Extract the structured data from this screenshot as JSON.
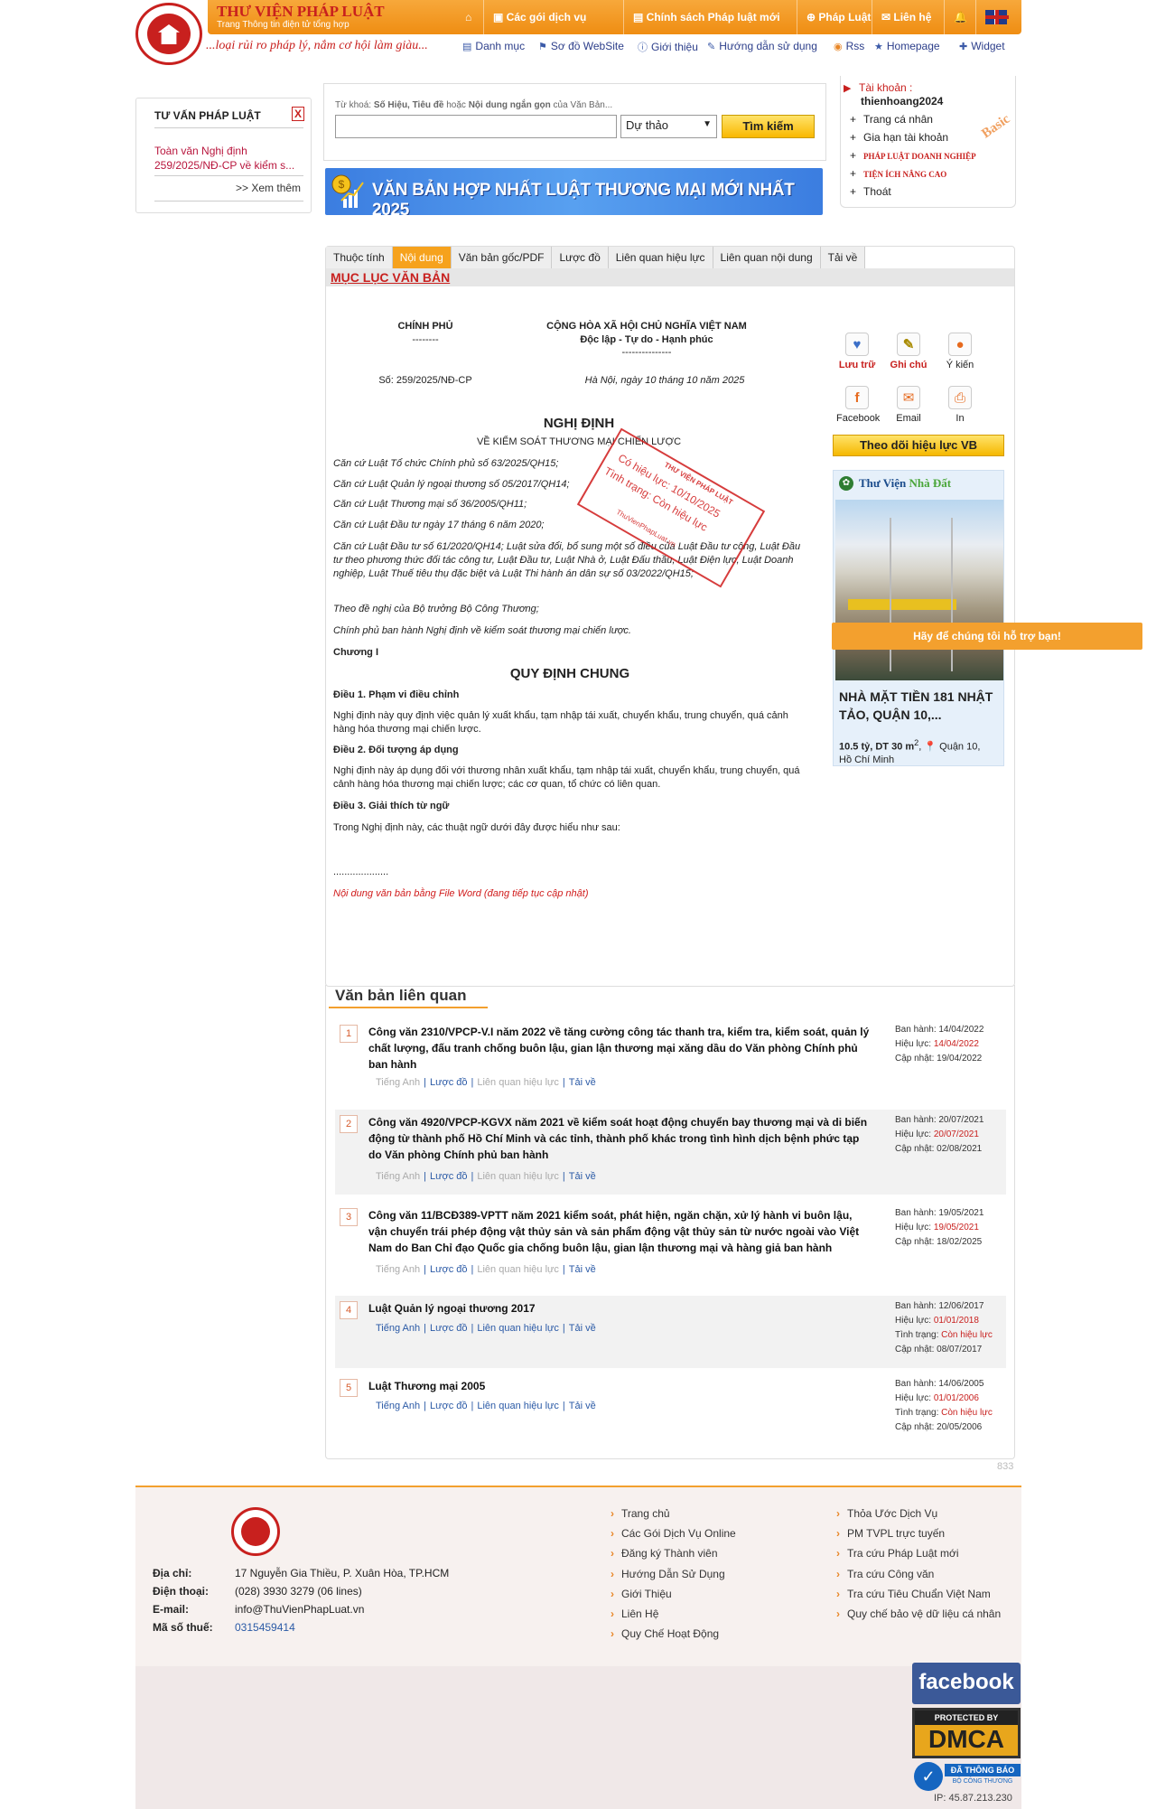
{
  "header": {
    "site_title": "THƯ VIỆN PHÁP LUẬT",
    "site_subtitle": "Trang Thông tin điện tử tổng hợp",
    "slogan": "...loại rủi ro pháp lý, nắm cơ hội làm giàu...",
    "topnav": [
      "Các gói dịch vụ",
      "Chính sách Pháp luật mới",
      "Pháp Luật",
      "Liên hệ"
    ],
    "subnav": [
      "Danh mục",
      "Sơ đồ WebSite",
      "Giới thiệu",
      "Hướng dẫn sử dụng",
      "Rss",
      "Homepage",
      "Widget"
    ]
  },
  "left_box": {
    "title": "TƯ VẤN PHÁP LUẬT",
    "close": "X",
    "link": "Toàn văn Nghị định 259/2025/NĐ-CP về kiểm s...",
    "more": ">> Xem thêm"
  },
  "search": {
    "hint_prefix": "Từ khoá: ",
    "hint_b1": "Số Hiệu, Tiêu đề",
    "hint_mid1": " hoặc ",
    "hint_b2": "Nội dung ngắn gọn",
    "hint_suffix": " của Văn Bản...",
    "value": "",
    "select": "Dự thảo",
    "button": "Tìm kiếm"
  },
  "banner": {
    "text": "VĂN BẢN HỢP NHẤT LUẬT THƯƠNG MẠI MỚI NHẤT 2025"
  },
  "account": {
    "label": "Tài khoản :",
    "username": "thienhoang2024",
    "items": [
      "Trang cá nhân",
      "Gia hạn tài khoản",
      "PHÁP LUẬT DOANH NGHIỆP",
      "TIỆN ÍCH NÂNG CAO",
      "Thoát"
    ],
    "badge": "Basic"
  },
  "tabs": [
    "Thuộc tính",
    "Nội dung",
    "Văn bản gốc/PDF",
    "Lược đồ",
    "Liên quan hiệu lực",
    "Liên quan nội dung",
    "Tải về"
  ],
  "toc": "MỤC LỤC VĂN BẢN",
  "document": {
    "agency": "CHÍNH PHỦ",
    "agency_line": "--------",
    "nation": "CỘNG HÒA XÃ HỘI CHỦ NGHĨA VIỆT NAM",
    "motto": "Độc lập - Tự do - Hạnh phúc",
    "motto_line": "---------------",
    "number": "Số: 259/2025/NĐ-CP",
    "date": "Hà Nội, ngày 10 tháng 10 năm 2025",
    "type": "NGHỊ ĐỊNH",
    "subject": "VỀ KIỂM SOÁT THƯƠNG MẠI CHIẾN LƯỢC",
    "bases": [
      "Căn cứ Luật Tổ chức Chính phủ số 63/2025/QH15;",
      "Căn cứ Luật Quản lý ngoại thương số 05/2017/QH14;",
      "Căn cứ Luật Thương mại số 36/2005/QH11;",
      "Căn cứ Luật Đầu tư ngày 17 tháng 6 năm 2020;",
      "Căn cứ Luật Đầu tư số 61/2020/QH14; Luật sửa đổi, bổ sung một số điều của Luật Đầu tư công, Luật Đầu tư theo phương thức đối tác công tư, Luật Đầu tư, Luật Nhà ở, Luật Đấu thầu, Luật Điện lực, Luật Doanh nghiệp, Luật Thuế tiêu thụ đặc biệt và Luật Thi hành án dân sự số 03/2022/QH15;",
      "Theo đề nghị của Bộ trưởng Bộ Công Thương;",
      "Chính phủ ban hành Nghị định về kiểm soát thương mại chiến lược."
    ],
    "chapter": "Chương I",
    "chapter_title": "QUY ĐỊNH CHUNG",
    "art1": "Điều 1. Phạm vi điều chỉnh",
    "art1_text": "Nghị định này quy định việc quản lý xuất khẩu, tạm nhập tái xuất, chuyển khẩu, trung chuyển, quá cảnh hàng hóa thương mại chiến lược.",
    "art2": "Điều 2. Đối tượng áp dụng",
    "art2_text": "Nghị định này áp dụng đối với thương nhân xuất khẩu, tạm nhập tái xuất, chuyển khẩu, trung chuyển, quá cảnh hàng hóa thương mại chiến lược; các cơ quan, tổ chức có liên quan.",
    "art3": "Điều 3. Giải thích từ ngữ",
    "art3_text": "Trong Nghị định này, các thuật ngữ dưới đây được hiểu như sau:",
    "dots": "....................",
    "note": "Nội dung văn bản bằng File Word (đang tiếp tục cập nhật)"
  },
  "stamp": {
    "brand": "THƯ VIỆN PHÁP LUẬT",
    "line1": "Có hiệu lực: 10/10/2025",
    "line2": "Tình trạng: Còn hiệu lực",
    "site": "ThuVienPhapLuat.vn"
  },
  "actions": [
    "Lưu trữ",
    "Ghi chú",
    "Ý kiến",
    "Facebook",
    "Email",
    "In"
  ],
  "follow": "Theo dõi hiệu lực VB",
  "ad": {
    "brand1": "Thư Viện",
    "brand2": "Nhà Đất",
    "title": "NHÀ MẶT TIỀN 181 NHẬT TẢO, QUẬN 10,...",
    "price": "10.5 tỷ, DT 30 m",
    "sup": "2",
    "location": "Quận 10, Hồ Chí Minh"
  },
  "support": "Hãy để chúng tôi hỗ trợ bạn!",
  "related": {
    "title": "Văn bản liên quan",
    "items": [
      {
        "num": "1",
        "title": "Công văn 2310/VPCP-V.I năm 2022 về tăng cường công tác thanh tra, kiểm tra, kiểm soát, quản lý chất lượng, đấu tranh chống buôn lậu, gian lận thương mại xăng dầu do Văn phòng Chính phủ ban hành",
        "l1": "Tiếng Anh",
        "l2": "Lược đồ",
        "l3": "Liên quan hiệu lực",
        "l4": "Tải về",
        "issued": "Ban hành: 14/04/2022",
        "effect_label": "Hiệu lực: ",
        "effect": "14/04/2022",
        "status_label": "",
        "status": "",
        "updated": "Cập nhật: 19/04/2022"
      },
      {
        "num": "2",
        "title": "Công văn 4920/VPCP-KGVX năm 2021 về kiểm soát hoạt động chuyển bay thương mại và di biến động từ thành phố Hồ Chí Minh và các tỉnh, thành phố khác trong tình hình dịch bệnh phức tạp do Văn phòng Chính phủ ban hành",
        "l1": "Tiếng Anh",
        "l2": "Lược đồ",
        "l3": "Liên quan hiệu lực",
        "l4": "Tải về",
        "issued": "Ban hành: 20/07/2021",
        "effect_label": "Hiệu lực: ",
        "effect": "20/07/2021",
        "status_label": "",
        "status": "",
        "updated": "Cập nhật: 02/08/2021"
      },
      {
        "num": "3",
        "title": "Công văn 11/BCĐ389-VPTT năm 2021 kiểm soát, phát hiện, ngăn chặn, xử lý hành vi buôn lậu, vận chuyển trái phép động vật thủy sản và sản phẩm động vật thủy sản từ nước ngoài vào Việt Nam do Ban Chỉ đạo Quốc gia chống buôn lậu, gian lận thương mại và hàng giả ban hành",
        "l1": "Tiếng Anh",
        "l2": "Lược đồ",
        "l3": "Liên quan hiệu lực",
        "l4": "Tải về",
        "issued": "Ban hành: 19/05/2021",
        "effect_label": "Hiệu lực: ",
        "effect": "19/05/2021",
        "status_label": "",
        "status": "",
        "updated": "Cập nhật: 18/02/2025"
      },
      {
        "num": "4",
        "title": "Luật Quản lý ngoại thương 2017",
        "l1": "Tiếng Anh",
        "l2": "Lược đồ",
        "l3": "Liên quan hiệu lực",
        "l4": "Tải về",
        "issued": "Ban hành: 12/06/2017",
        "effect_label": "Hiệu lực: ",
        "effect": "01/01/2018",
        "status_label": "Tình trạng: ",
        "status": "Còn hiệu lực",
        "updated": "Cập nhật: 08/07/2017"
      },
      {
        "num": "5",
        "title": "Luật Thương mại 2005",
        "l1": "Tiếng Anh",
        "l2": "Lược đồ",
        "l3": "Liên quan hiệu lực",
        "l4": "Tải về",
        "issued": "Ban hành: 14/06/2005",
        "effect_label": "Hiệu lực: ",
        "effect": "01/01/2006",
        "status_label": "Tình trạng: ",
        "status": "Còn hiệu lực",
        "updated": "Cập nhật: 20/05/2006"
      }
    ]
  },
  "counter": "833",
  "footer": {
    "address_label": "Địa chỉ:",
    "address": "17 Nguyễn Gia Thiều, P. Xuân Hòa, TP.HCM",
    "phone_label": "Điện thoại:",
    "phone": "(028) 3930 3279 (06 lines)",
    "email_label": "E-mail:",
    "email": "info@ThuVienPhapLuat.vn",
    "tax_label": "Mã số thuế:",
    "tax": "0315459414",
    "col1": [
      "Trang chủ",
      "Các Gói Dịch Vụ Online",
      "Đăng ký Thành viên",
      "Hướng Dẫn Sử Dụng",
      "Giới Thiệu",
      "Liên Hệ",
      "Quy Chế Hoạt Động"
    ],
    "col2": [
      "Thỏa Ước Dịch Vụ",
      "PM TVPL trực tuyến",
      "Tra cứu Pháp Luật mới",
      "Tra cứu Công văn",
      "Tra cứu Tiêu Chuẩn Việt Nam",
      "Quy chế bảo vệ dữ liệu cá nhân"
    ]
  },
  "badges": {
    "facebook": "facebook",
    "dmca_top": "PROTECTED BY",
    "dmca": "DMCA",
    "bct1": "ĐÃ THÔNG BÁO",
    "bct2": "BỘ CÔNG THƯƠNG"
  },
  "ip": "IP: 45.87.213.230",
  "colors": {
    "brand_red": "#c8201e",
    "accent_orange": "#f3a02e",
    "link_blue": "#2b5aa6"
  }
}
